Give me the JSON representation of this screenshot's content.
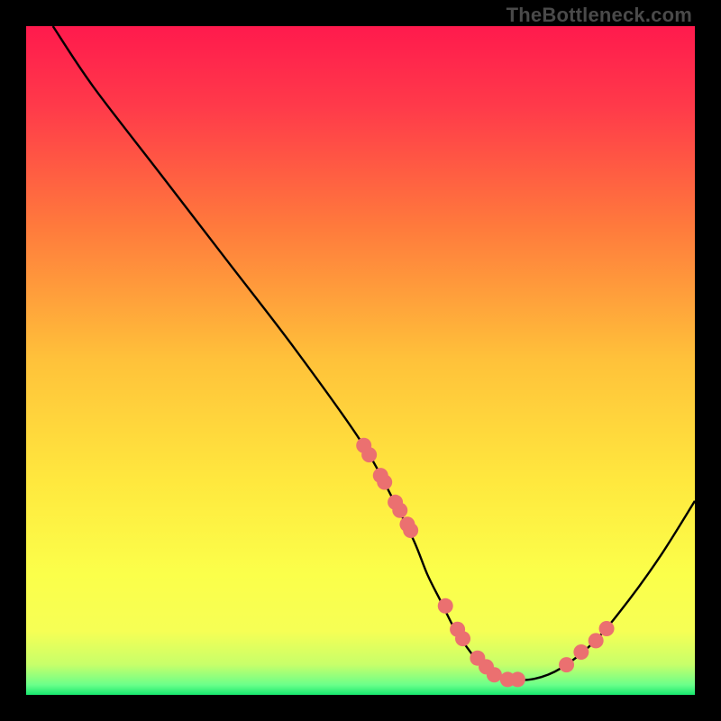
{
  "watermark": "TheBottleneck.com",
  "colors": {
    "background": "#000000",
    "curve": "#000000",
    "marker": "#eb7070",
    "gradient_stops": [
      {
        "offset": 0,
        "color": "#ff1a4d"
      },
      {
        "offset": 0.12,
        "color": "#ff3a4a"
      },
      {
        "offset": 0.3,
        "color": "#ff7a3c"
      },
      {
        "offset": 0.5,
        "color": "#ffc23a"
      },
      {
        "offset": 0.68,
        "color": "#ffe83e"
      },
      {
        "offset": 0.82,
        "color": "#fbff4a"
      },
      {
        "offset": 0.905,
        "color": "#f6ff55"
      },
      {
        "offset": 0.955,
        "color": "#c7ff6a"
      },
      {
        "offset": 0.985,
        "color": "#6bff8a"
      },
      {
        "offset": 1.0,
        "color": "#17e86f"
      }
    ]
  },
  "chart_data": {
    "type": "line",
    "title": "",
    "xlabel": "",
    "ylabel": "",
    "x_range": [
      0,
      100
    ],
    "y_range": [
      0,
      100
    ],
    "series": [
      {
        "name": "bottleneck-curve",
        "x": [
          4,
          10,
          20,
          30,
          40,
          50,
          55,
          58,
          60,
          62,
          64,
          66,
          68,
          70,
          72,
          76,
          80,
          85,
          90,
          95,
          100
        ],
        "y": [
          100,
          91,
          78,
          65,
          52,
          38,
          29,
          23,
          18,
          14,
          10,
          7,
          4.5,
          3,
          2.3,
          2.4,
          4,
          8,
          14,
          21,
          29
        ]
      }
    ],
    "markers": {
      "name": "highlighted-points",
      "x": [
        50.5,
        51.3,
        53.0,
        53.6,
        55.2,
        55.9,
        57.0,
        57.5,
        62.7,
        64.5,
        65.3,
        67.5,
        68.8,
        70.0,
        72.0,
        73.5,
        80.8,
        83.0,
        85.2,
        86.8
      ],
      "y": [
        37.3,
        35.9,
        32.8,
        31.8,
        28.8,
        27.6,
        25.5,
        24.6,
        13.3,
        9.8,
        8.4,
        5.5,
        4.2,
        3.0,
        2.3,
        2.3,
        4.5,
        6.4,
        8.1,
        9.9
      ]
    }
  }
}
